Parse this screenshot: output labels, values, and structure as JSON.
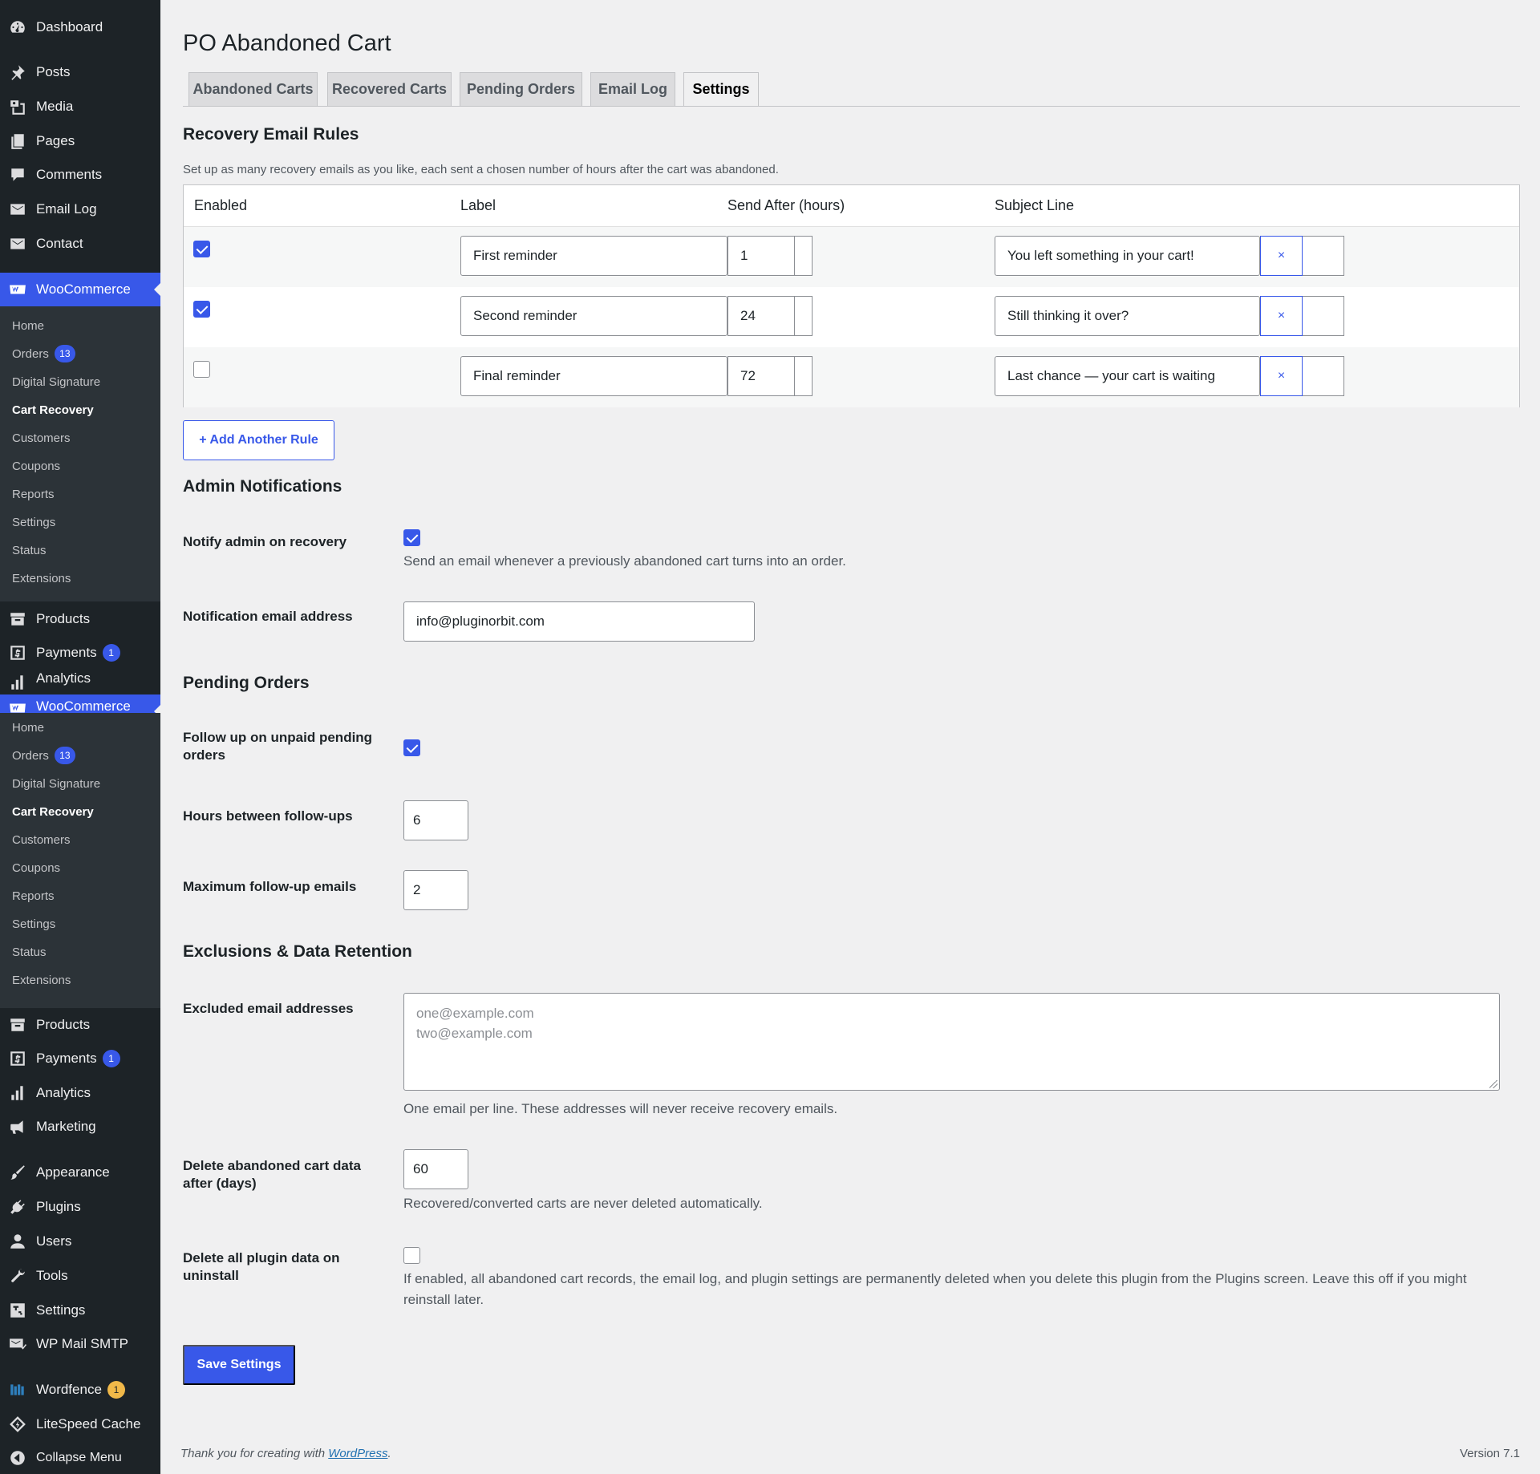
{
  "sidebar": {
    "top_items": [
      {
        "label": "Dashboard",
        "icon": "dashboard-icon"
      },
      {
        "label": "Posts",
        "icon": "pin-icon"
      },
      {
        "label": "Media",
        "icon": "media-icon"
      },
      {
        "label": "Pages",
        "icon": "pages-icon"
      },
      {
        "label": "Comments",
        "icon": "comment-icon"
      },
      {
        "label": "Email Log",
        "icon": "envelope-icon"
      },
      {
        "label": "Contact",
        "icon": "envelope-icon"
      }
    ],
    "woocommerce": {
      "label": "WooCommerce",
      "icon": "woo-icon"
    },
    "woo_submenu": [
      {
        "label": "Home"
      },
      {
        "label": "Orders",
        "badge": "13"
      },
      {
        "label": "Digital Signature"
      },
      {
        "label": "Cart Recovery"
      },
      {
        "label": "Customers"
      },
      {
        "label": "Coupons"
      },
      {
        "label": "Reports"
      },
      {
        "label": "Settings"
      },
      {
        "label": "Status"
      },
      {
        "label": "Extensions"
      }
    ],
    "mid_items": [
      {
        "label": "Products",
        "icon": "archive-icon"
      },
      {
        "label": "Payments",
        "icon": "dollar-icon",
        "badge": "1"
      },
      {
        "label": "Analytics",
        "icon": "bar-chart-icon"
      }
    ],
    "bottom_items": [
      {
        "label": "Products",
        "icon": "archive-icon"
      },
      {
        "label": "Payments",
        "icon": "dollar-icon",
        "badge": "1"
      },
      {
        "label": "Analytics",
        "icon": "bar-chart-icon"
      },
      {
        "label": "Marketing",
        "icon": "megaphone-icon"
      },
      {
        "label": "Appearance",
        "icon": "brush-icon"
      },
      {
        "label": "Plugins",
        "icon": "plugin-icon"
      },
      {
        "label": "Users",
        "icon": "user-icon"
      },
      {
        "label": "Tools",
        "icon": "wrench-icon"
      },
      {
        "label": "Settings",
        "icon": "settings-icon"
      },
      {
        "label": "WP Mail SMTP",
        "icon": "mail-smtp-icon"
      },
      {
        "label": "Wordfence",
        "icon": "wordfence-icon",
        "badge": "1"
      },
      {
        "label": "LiteSpeed Cache",
        "icon": "litespeed-icon"
      },
      {
        "label": "Collapse Menu",
        "icon": "collapse-icon"
      }
    ]
  },
  "page": {
    "title": "PO Abandoned Cart",
    "tabs": [
      {
        "label": "Abandoned Carts"
      },
      {
        "label": "Recovered Carts"
      },
      {
        "label": "Pending Orders"
      },
      {
        "label": "Email Log"
      },
      {
        "label": "Settings",
        "active": true
      }
    ]
  },
  "recovery_rules": {
    "heading": "Recovery Email Rules",
    "description": "Set up as many recovery emails as you like, each sent a chosen number of hours after the cart was abandoned.",
    "columns": {
      "enabled": "Enabled",
      "label": "Label",
      "send_after": "Send After (hours)",
      "subject": "Subject Line"
    },
    "rows": [
      {
        "enabled": true,
        "label": "First reminder",
        "hours": "1",
        "subject": "You left something in your cart!"
      },
      {
        "enabled": true,
        "label": "Second reminder",
        "hours": "24",
        "subject": "Still thinking it over?"
      },
      {
        "enabled": false,
        "label": "Final reminder",
        "hours": "72",
        "subject": "Last chance — your cart is waiting"
      }
    ],
    "remove_symbol": "×",
    "add_button": "+ Add Another Rule"
  },
  "admin_notifications": {
    "heading": "Admin Notifications",
    "notify_label": "Notify admin on recovery",
    "notify_checked": true,
    "notify_help": "Send an email whenever a previously abandoned cart turns into an order.",
    "email_label": "Notification email address",
    "email_value": "info@pluginorbit.com"
  },
  "pending_orders": {
    "heading": "Pending Orders",
    "follow_label": "Follow up on unpaid pending orders",
    "follow_checked": true,
    "hours_label": "Hours between follow-ups",
    "hours_value": "6",
    "max_label": "Maximum follow-up emails",
    "max_value": "2"
  },
  "exclusions": {
    "heading": "Exclusions & Data Retention",
    "excluded_label": "Excluded email addresses",
    "excluded_placeholder_line1": "one@example.com",
    "excluded_placeholder_line2": "two@example.com",
    "excluded_help": "One email per line. These addresses will never receive recovery emails.",
    "delete_days_label": "Delete abandoned cart data after (days)",
    "delete_days_value": "60",
    "delete_days_help": "Recovered/converted carts are never deleted automatically.",
    "delete_all_label": "Delete all plugin data on uninstall",
    "delete_all_checked": false,
    "delete_all_help": "If enabled, all abandoned cart records, the email log, and plugin settings are permanently deleted when you delete this plugin from the Plugins screen. Leave this off if you might reinstall later."
  },
  "save_button": "Save Settings",
  "footer": {
    "thanks_prefix": "Thank you for creating with",
    "thanks_link": "WordPress",
    "thanks_suffix": ".",
    "version": "Version 7.1"
  },
  "colors": {
    "accent": "#3858e9",
    "sidebar_bg": "#1d2327",
    "page_bg": "#f0f0f1"
  }
}
